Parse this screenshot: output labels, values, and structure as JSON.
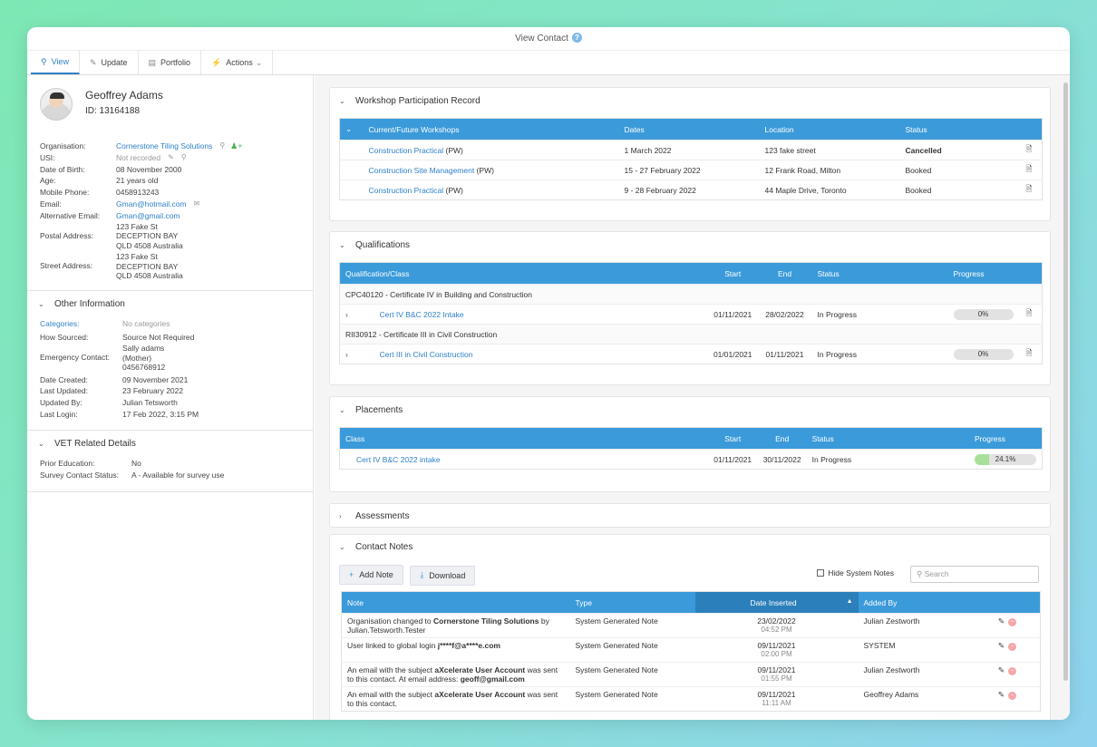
{
  "window": {
    "title": "View Contact"
  },
  "tabs": [
    {
      "label": "View",
      "icon": "search-icon"
    },
    {
      "label": "Update",
      "icon": "pencil-icon"
    },
    {
      "label": "Portfolio",
      "icon": "portfolio-icon"
    },
    {
      "label": "Actions",
      "icon": "bolt-icon"
    }
  ],
  "profile": {
    "name": "Geoffrey Adams",
    "id": "ID: 13164188"
  },
  "details": {
    "organisation": {
      "label": "Organisation:",
      "value": "Cornerstone Tiling Solutions"
    },
    "usi": {
      "label": "USI:",
      "value": "Not recorded"
    },
    "dob": {
      "label": "Date of Birth:",
      "value": "08 November 2000"
    },
    "age": {
      "label": "Age:",
      "value": "21 years old"
    },
    "mobile": {
      "label": "Mobile Phone:",
      "value": "0458913243"
    },
    "email": {
      "label": "Email:",
      "value": "Gman@hotmail.com"
    },
    "alt_email": {
      "label": "Alternative Email:",
      "value": "Gman@gmail.com"
    },
    "postal": {
      "label": "Postal Address:",
      "lines": [
        "123 Fake St",
        "DECEPTION BAY",
        "QLD 4508 Australia"
      ]
    },
    "street": {
      "label": "Street Address:",
      "lines": [
        "123 Fake St",
        "DECEPTION BAY",
        "QLD 4508 Australia"
      ]
    }
  },
  "other_info": {
    "title": "Other Information",
    "categories": {
      "label": "Categories:",
      "value": "No categories"
    },
    "how_sourced": {
      "label": "How Sourced:",
      "value": "Source Not Required"
    },
    "emergency": {
      "label": "Emergency Contact:",
      "lines": [
        "Sally adams",
        "(Mother)",
        "0456768912"
      ]
    },
    "date_created": {
      "label": "Date Created:",
      "value": "09 November 2021"
    },
    "last_updated": {
      "label": "Last Updated:",
      "value": "23 February 2022"
    },
    "updated_by": {
      "label": "Updated By:",
      "value": "Julian Tetsworth"
    },
    "last_login": {
      "label": "Last Login:",
      "value": "17 Feb 2022, 3:15 PM"
    }
  },
  "vet": {
    "title": "VET Related Details",
    "prior_education": {
      "label": "Prior Education:",
      "value": "No"
    },
    "survey": {
      "label": "Survey Contact Status:",
      "value": "A - Available for survey use"
    }
  },
  "workshops": {
    "title": "Workshop Participation Record",
    "headers": [
      "Current/Future Workshops",
      "Dates",
      "Location",
      "Status"
    ],
    "rows": [
      {
        "name": "Construction Practical",
        "suffix": " (PW)",
        "dates": "1 March 2022",
        "location": "123 fake street",
        "status": "Cancelled"
      },
      {
        "name": "Construction Site Management",
        "suffix": " (PW)",
        "dates": "15 - 27 February 2022",
        "location": "12 Frank Road, Milton",
        "status": "Booked"
      },
      {
        "name": "Construction Practical",
        "suffix": " (PW)",
        "dates": "9 - 28 February 2022",
        "location": "44 Maple Drive, Toronto",
        "status": "Booked"
      }
    ]
  },
  "qualifications": {
    "title": "Qualifications",
    "headers": [
      "Qualification/Class",
      "Start",
      "End",
      "Status",
      "Progress"
    ],
    "groups": [
      {
        "name": "CPC40120 - Certificate IV in Building and Construction",
        "class": "Cert IV B&C 2022 Intake",
        "start": "01/11/2021",
        "end": "28/02/2022",
        "status": "In Progress",
        "progress": "0%",
        "progress_value": 0
      },
      {
        "name": "RII30912 - Certificate III in Civil Construction",
        "class": "Cert III in Civil Construction",
        "start": "01/01/2021",
        "end": "01/11/2021",
        "status": "In Progress",
        "progress": "0%",
        "progress_value": 0
      }
    ]
  },
  "placements": {
    "title": "Placements",
    "headers": [
      "Class",
      "Start",
      "End",
      "Status",
      "Progress"
    ],
    "rows": [
      {
        "class": "Cert IV B&C 2022 intake",
        "start": "01/11/2021",
        "end": "30/11/2022",
        "status": "In Progress",
        "progress": "24.1%",
        "progress_value": 24.1
      }
    ]
  },
  "assessments": {
    "title": "Assessments"
  },
  "notes": {
    "title": "Contact Notes",
    "add_label": "Add Note",
    "download_label": "Download",
    "hide_system_label": "Hide System Notes",
    "search_placeholder": "Search",
    "headers": [
      "Note",
      "Type",
      "Date Inserted",
      "Added By"
    ],
    "rows": [
      {
        "pre": "Organisation changed to ",
        "bold": "Cornerstone Tiling Solutions",
        "post": " by Julian.Tetsworth.Tester",
        "type": "System Generated Note",
        "date": "23/02/2022",
        "time": "04:52 PM",
        "by": "Julian Zestworth"
      },
      {
        "pre": "User linked to global login ",
        "bold": "j****f@a****e.com",
        "post": "",
        "type": "System Generated Note",
        "date": "09/11/2021",
        "time": "02:00 PM",
        "by": "SYSTEM"
      },
      {
        "pre": "An email with the subject ",
        "bold": "aXcelerate User Account",
        "post": " was sent to this contact. At email address: ",
        "bold2": "geoff@gmail.com",
        "type": "System Generated Note",
        "date": "09/11/2021",
        "time": "01:55 PM",
        "by": "Julian Zestworth"
      },
      {
        "pre": "An email with the subject ",
        "bold": "aXcelerate User Account",
        "post": " was sent to this contact.",
        "type": "System Generated Note",
        "date": "09/11/2021",
        "time": "11:11 AM",
        "by": "Geoffrey Adams"
      }
    ]
  }
}
